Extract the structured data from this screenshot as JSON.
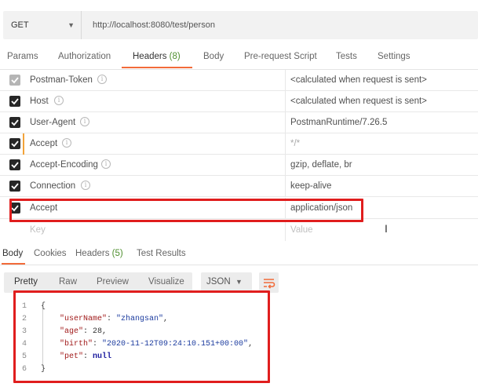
{
  "request": {
    "method": "GET",
    "url": "http://localhost:8080/test/person"
  },
  "request_tabs": [
    {
      "label": "Params",
      "count": ""
    },
    {
      "label": "Authorization",
      "count": ""
    },
    {
      "label": "Headers",
      "count": "(8)"
    },
    {
      "label": "Body",
      "count": ""
    },
    {
      "label": "Pre-request Script",
      "count": ""
    },
    {
      "label": "Tests",
      "count": ""
    },
    {
      "label": "Settings",
      "count": ""
    }
  ],
  "headers": [
    {
      "key": "Postman-Token",
      "value": "<calculated when request is sent>",
      "checked": true,
      "locked": true
    },
    {
      "key": "Host",
      "value": "<calculated when request is sent>",
      "checked": true
    },
    {
      "key": "User-Agent",
      "value": "PostmanRuntime/7.26.5",
      "checked": true
    },
    {
      "key": "Accept",
      "value": "*/*",
      "checked": true
    },
    {
      "key": "Accept-Encoding",
      "value": "gzip, deflate, br",
      "checked": true
    },
    {
      "key": "Connection",
      "value": "keep-alive",
      "checked": true
    },
    {
      "key": "Accept",
      "value": "application/json",
      "checked": true
    }
  ],
  "new_header": {
    "key_placeholder": "Key",
    "value_placeholder": "Value"
  },
  "response_tabs": [
    {
      "label": "Body",
      "count": ""
    },
    {
      "label": "Cookies",
      "count": ""
    },
    {
      "label": "Headers",
      "count": "(5)"
    },
    {
      "label": "Test Results",
      "count": ""
    }
  ],
  "view_modes": [
    "Pretty",
    "Raw",
    "Preview",
    "Visualize"
  ],
  "format": "JSON",
  "code": {
    "line_numbers": [
      "1",
      "2",
      "3",
      "4",
      "5",
      "6"
    ],
    "open_brace": "{",
    "close_brace": "}",
    "fields": [
      {
        "key": "\"userName\"",
        "value": "\"zhangsan\"",
        "kind": "string"
      },
      {
        "key": "\"age\"",
        "value": "28",
        "kind": "number"
      },
      {
        "key": "\"birth\"",
        "value": "\"2020-11-12T09:24:10.151+00:00\"",
        "kind": "string"
      },
      {
        "key": "\"pet\"",
        "value": "null",
        "kind": "keyword"
      }
    ]
  },
  "colors": {
    "accent": "#f26b3a",
    "highlight": "#e01e1e",
    "count": "#4f8f2f"
  }
}
